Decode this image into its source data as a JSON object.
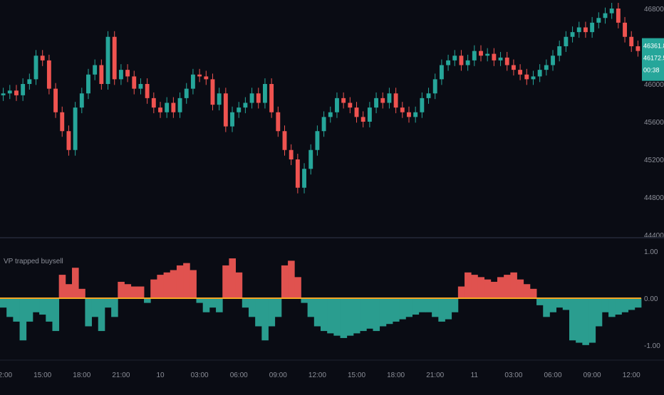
{
  "colors": {
    "background": "#0a0c14",
    "divider": "#1e2230",
    "axis_text": "#8c8f99",
    "candle_up": "#26a69a",
    "candle_down": "#ef5350",
    "price_label_bg": "#26a69a",
    "price_label_text": "#ffffff",
    "osc_positive": "#e0524f",
    "osc_negative": "#2a9d8f",
    "zero_line": "#f5a623"
  },
  "price_labels": {
    "last_price": "46361.87",
    "secondary": "46172.55",
    "countdown": "00:38"
  },
  "chart_data": [
    {
      "type": "candlestick",
      "title": "",
      "y_ticks": [
        "46800.00",
        "46400.00",
        "46000.00",
        "45600.00",
        "45200.00",
        "44800.00",
        "44400.00"
      ],
      "ylim": [
        44400,
        46800
      ],
      "x": [
        "12:00",
        "12:30",
        "13:00",
        "13:30",
        "14:00",
        "14:30",
        "15:00",
        "15:30",
        "16:00",
        "16:30",
        "17:00",
        "17:30",
        "18:00",
        "18:30",
        "19:00",
        "19:30",
        "20:00",
        "20:30",
        "21:00",
        "21:30",
        "22:00",
        "22:30",
        "23:00",
        "23:30",
        "10",
        "00:30",
        "01:00",
        "01:30",
        "02:00",
        "02:30",
        "03:00",
        "03:30",
        "04:00",
        "04:30",
        "05:00",
        "05:30",
        "06:00",
        "06:30",
        "07:00",
        "07:30",
        "08:00",
        "08:30",
        "09:00",
        "09:30",
        "10:00",
        "10:30",
        "11:00",
        "11:30",
        "12:00",
        "12:30",
        "13:00",
        "13:30",
        "14:00",
        "14:30",
        "15:00",
        "15:30",
        "16:00",
        "16:30",
        "17:00",
        "17:30",
        "18:00",
        "18:30",
        "19:00",
        "19:30",
        "20:00",
        "20:30",
        "21:00",
        "21:30",
        "22:00",
        "22:30",
        "23:00",
        "23:30",
        "11",
        "00:30",
        "01:00",
        "01:30",
        "02:00",
        "02:30",
        "03:00",
        "03:30",
        "04:00",
        "04:30",
        "05:00",
        "05:30",
        "06:00",
        "06:30",
        "07:00",
        "07:30",
        "08:00",
        "08:30",
        "09:00",
        "09:30",
        "10:00",
        "10:30",
        "11:00",
        "11:30",
        "12:00",
        "12:30"
      ],
      "close": [
        45900,
        45930,
        45880,
        46000,
        46050,
        46300,
        46250,
        45950,
        45700,
        45500,
        45300,
        45750,
        45900,
        46100,
        46200,
        46000,
        46500,
        46050,
        46150,
        46080,
        45950,
        46000,
        45850,
        45750,
        45700,
        45800,
        45700,
        45850,
        45950,
        46100,
        46080,
        46050,
        45780,
        45900,
        45550,
        45700,
        45750,
        45800,
        45900,
        45800,
        46000,
        45700,
        45500,
        45300,
        45200,
        44900,
        45100,
        45300,
        45500,
        45650,
        45700,
        45850,
        45800,
        45750,
        45650,
        45600,
        45750,
        45850,
        45800,
        45900,
        45750,
        45700,
        45650,
        45700,
        45850,
        45900,
        46050,
        46200,
        46250,
        46300,
        46200,
        46250,
        46350,
        46300,
        46320,
        46250,
        46280,
        46200,
        46150,
        46100,
        46050,
        46080,
        46150,
        46200,
        46300,
        46400,
        46500,
        46550,
        46600,
        46550,
        46650,
        46700,
        46750,
        46800,
        46650,
        46500,
        46400,
        46350
      ]
    },
    {
      "type": "area",
      "title": "VP trapped buysell",
      "y_ticks": [
        "1.00",
        "0.00",
        "-1.00"
      ],
      "ylim": [
        -1.2,
        1.2
      ],
      "x": [
        "12:00",
        "12:30",
        "13:00",
        "13:30",
        "14:00",
        "14:30",
        "15:00",
        "15:30",
        "16:00",
        "16:30",
        "17:00",
        "17:30",
        "18:00",
        "18:30",
        "19:00",
        "19:30",
        "20:00",
        "20:30",
        "21:00",
        "21:30",
        "22:00",
        "22:30",
        "23:00",
        "23:30",
        "10",
        "00:30",
        "01:00",
        "01:30",
        "02:00",
        "02:30",
        "03:00",
        "03:30",
        "04:00",
        "04:30",
        "05:00",
        "05:30",
        "06:00",
        "06:30",
        "07:00",
        "07:30",
        "08:00",
        "08:30",
        "09:00",
        "09:30",
        "10:00",
        "10:30",
        "11:00",
        "11:30",
        "12:00",
        "12:30",
        "13:00",
        "13:30",
        "14:00",
        "14:30",
        "15:00",
        "15:30",
        "16:00",
        "16:30",
        "17:00",
        "17:30",
        "18:00",
        "18:30",
        "19:00",
        "19:30",
        "20:00",
        "20:30",
        "21:00",
        "21:30",
        "22:00",
        "22:30",
        "23:00",
        "23:30",
        "11",
        "00:30",
        "01:00",
        "01:30",
        "02:00",
        "02:30",
        "03:00",
        "03:30",
        "04:00",
        "04:30",
        "05:00",
        "05:30",
        "06:00",
        "06:30",
        "07:00",
        "07:30",
        "08:00",
        "08:30",
        "09:00",
        "09:30",
        "10:00",
        "10:30",
        "11:00",
        "11:30",
        "12:00",
        "12:30"
      ],
      "values": [
        -0.2,
        -0.4,
        -0.5,
        -0.9,
        -0.5,
        -0.3,
        -0.35,
        -0.5,
        -0.7,
        0.5,
        0.3,
        0.65,
        0.2,
        -0.6,
        -0.4,
        -0.7,
        -0.2,
        -0.4,
        0.35,
        0.3,
        0.25,
        0.25,
        -0.1,
        0.4,
        0.5,
        0.55,
        0.6,
        0.7,
        0.75,
        0.6,
        -0.1,
        -0.3,
        -0.2,
        -0.3,
        0.7,
        0.85,
        0.55,
        -0.2,
        -0.4,
        -0.6,
        -0.9,
        -0.6,
        -0.4,
        0.7,
        0.8,
        0.45,
        -0.1,
        -0.4,
        -0.6,
        -0.7,
        -0.75,
        -0.8,
        -0.85,
        -0.8,
        -0.75,
        -0.7,
        -0.65,
        -0.7,
        -0.6,
        -0.55,
        -0.5,
        -0.45,
        -0.4,
        -0.35,
        -0.3,
        -0.3,
        -0.4,
        -0.5,
        -0.45,
        -0.3,
        0.25,
        0.55,
        0.5,
        0.45,
        0.4,
        0.35,
        0.45,
        0.5,
        0.55,
        0.4,
        0.3,
        0.2,
        -0.15,
        -0.4,
        -0.3,
        -0.2,
        -0.25,
        -0.9,
        -0.95,
        -1.0,
        -0.95,
        -0.6,
        -0.3,
        -0.4,
        -0.35,
        -0.3,
        -0.25,
        -0.2
      ]
    }
  ],
  "time_axis": {
    "labels": [
      "12:00",
      "15:00",
      "18:00",
      "21:00",
      "10",
      "03:00",
      "06:00",
      "09:00",
      "12:00",
      "15:00",
      "18:00",
      "21:00",
      "11",
      "03:00",
      "06:00",
      "09:00",
      "12:00"
    ],
    "label_indices": [
      0,
      6,
      12,
      18,
      24,
      30,
      36,
      42,
      48,
      54,
      60,
      66,
      72,
      78,
      84,
      90,
      96
    ]
  }
}
